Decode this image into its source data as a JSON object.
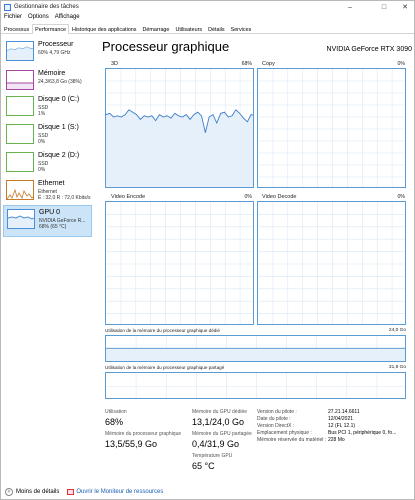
{
  "window": {
    "title": "Gestionnaire des tâches"
  },
  "menu": [
    "Fichier",
    "Options",
    "Affichage"
  ],
  "tabs": [
    "Processus",
    "Performance",
    "Historique des applications",
    "Démarrage",
    "Utilisateurs",
    "Détails",
    "Services"
  ],
  "sidebar": {
    "items": [
      {
        "label": "Processeur",
        "sub1": "60% 4,79 GHz",
        "sub2": "",
        "sub3": ""
      },
      {
        "label": "Mémoire",
        "sub1": "24,3/63,8 Go (38%)",
        "sub2": "",
        "sub3": ""
      },
      {
        "label": "Disque 0 (C:)",
        "sub1": "SSD",
        "sub2": "1%",
        "sub3": ""
      },
      {
        "label": "Disque 1 (S:)",
        "sub1": "SSD",
        "sub2": "0%",
        "sub3": ""
      },
      {
        "label": "Disque 2 (D:)",
        "sub1": "SSD",
        "sub2": "0%",
        "sub3": ""
      },
      {
        "label": "Ethernet",
        "sub1": "Ethernet",
        "sub2": "É : 32,0  R : 72,0 Kbits/s",
        "sub3": ""
      },
      {
        "label": "GPU 0",
        "sub1": "NVIDIA GeForce R...",
        "sub2": "68% (65 °C)",
        "sub3": ""
      }
    ]
  },
  "main": {
    "title": "Processeur graphique",
    "gpu_name": "NVIDIA GeForce RTX 3090",
    "graphs": {
      "g3d": {
        "label": "3D",
        "pct": "68%"
      },
      "copy": {
        "label": "Copy",
        "pct": "0%"
      },
      "venc": {
        "label": "Video Encode",
        "pct": "0%"
      },
      "vdec": {
        "label": "Video Decode",
        "pct": "0%"
      },
      "dedicated": {
        "label": "Utilisation de la mémoire du processeur graphique dédié",
        "max": "24,0 Go"
      },
      "shared": {
        "label": "Utilisation de la mémoire du processeur graphique partagé",
        "max": "31,9 Go"
      }
    },
    "stats": {
      "utilisation_label": "Utilisation",
      "utilisation_value": "68%",
      "dedicated_label": "Mémoire du GPU dédiée",
      "dedicated_value": "13,1/24,0 Go",
      "gpu_mem_label": "Mémoire du processeur graphique",
      "gpu_mem_value": "13,5/55,9 Go",
      "shared_label": "Mémoire du GPU partagée",
      "shared_value": "0,4/31,9 Go",
      "temp_label": "Température GPU",
      "temp_value": "65 °C"
    },
    "info": [
      {
        "label": "Version du pilote :",
        "value": "27.21.14.6611"
      },
      {
        "label": "Date du pilote :",
        "value": "12/04/2021"
      },
      {
        "label": "Version DirectX :",
        "value": "12 (FL 12.1)"
      },
      {
        "label": "Emplacement physique :",
        "value": "Bus PCI 1, périphérique 0, fo..."
      },
      {
        "label": "Mémoire réservée du matériel :",
        "value": "228 Mo"
      }
    ]
  },
  "footer": {
    "less_details": "Moins de détails",
    "resource_monitor": "Ouvrir le Moniteur de ressources"
  },
  "chart_data": {
    "type": "line",
    "title": "3D",
    "series": [
      {
        "values": [
          62,
          63,
          60,
          61,
          60,
          62,
          66,
          64,
          62,
          58,
          61,
          60,
          61,
          57,
          62,
          60,
          61,
          59,
          63,
          61,
          60,
          62,
          58,
          62,
          64,
          61,
          47,
          60,
          62,
          55,
          63,
          64,
          60,
          61,
          66,
          63,
          59,
          56,
          62,
          61
        ]
      }
    ],
    "ylim": [
      0,
      100
    ]
  }
}
